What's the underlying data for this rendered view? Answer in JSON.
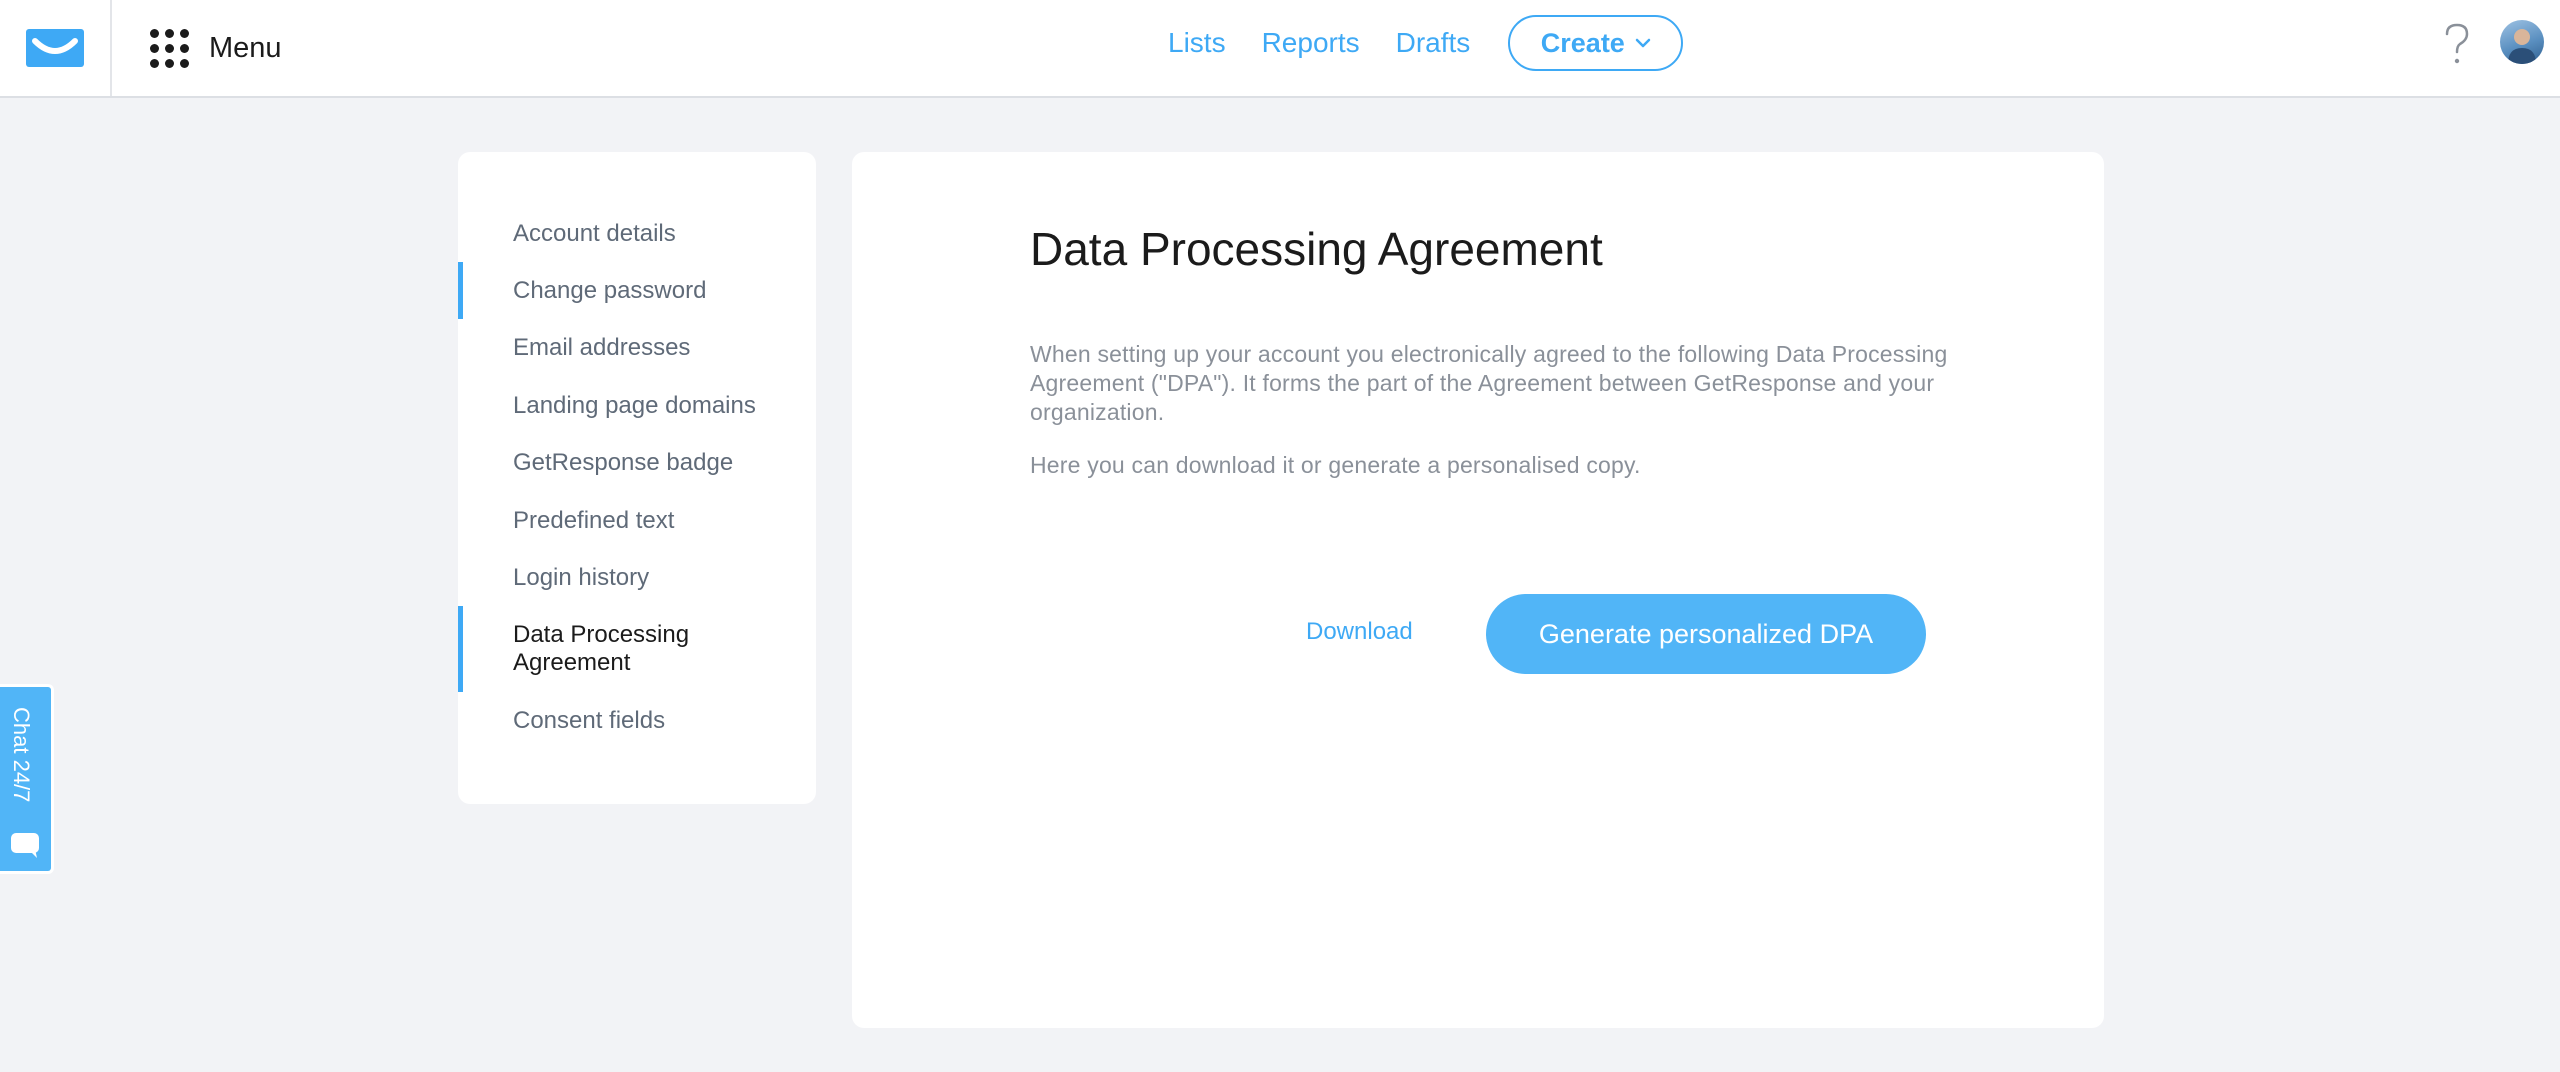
{
  "header": {
    "menu_label": "Menu",
    "nav": [
      "Lists",
      "Reports",
      "Drafts"
    ],
    "create_label": "Create"
  },
  "sidebar": {
    "items": [
      {
        "label": "Account details",
        "active": false,
        "marker": false
      },
      {
        "label": "Change password",
        "active": false,
        "marker": true
      },
      {
        "label": "Email addresses",
        "active": false,
        "marker": false
      },
      {
        "label": "Landing page domains",
        "active": false,
        "marker": false
      },
      {
        "label": "GetResponse badge",
        "active": false,
        "marker": false
      },
      {
        "label": "Predefined text",
        "active": false,
        "marker": false
      },
      {
        "label": "Login history",
        "active": false,
        "marker": false
      },
      {
        "label": "Data Processing Agreement",
        "active": true,
        "marker": true
      },
      {
        "label": "Consent fields",
        "active": false,
        "marker": false
      }
    ]
  },
  "main": {
    "title": "Data Processing Agreement",
    "paragraph1": "When setting up your account you electronically agreed to the following Data Processing Agreement (\"DPA\"). It forms the part of the Agreement between GetResponse and your organization.",
    "paragraph2": "Here you can download it or generate a personalised copy.",
    "download_label": "Download",
    "generate_label": "Generate personalized DPA"
  },
  "chat": {
    "label": "Chat 24/7"
  },
  "colors": {
    "accent": "#3ea9f5",
    "button": "#51b5f7",
    "background": "#f2f3f6"
  }
}
